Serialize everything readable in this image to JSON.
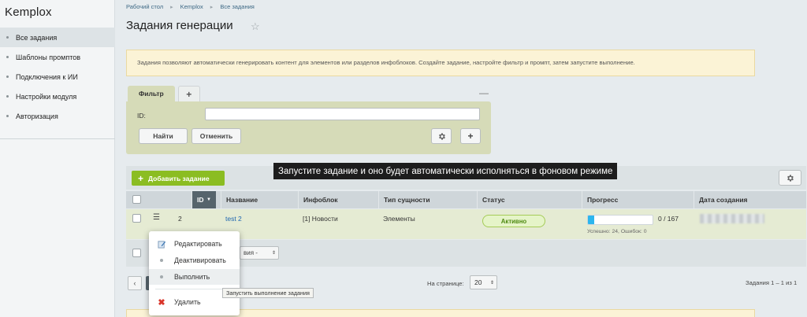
{
  "app": {
    "logo": "Kemplox"
  },
  "sidebar": {
    "items": [
      {
        "label": "Все задания",
        "active": true
      },
      {
        "label": "Шаблоны промптов"
      },
      {
        "label": "Подключения к ИИ"
      },
      {
        "label": "Настройки модуля"
      },
      {
        "label": "Авторизация"
      }
    ]
  },
  "breadcrumb": [
    "Рабочий стол",
    "Kemplox",
    "Все задания"
  ],
  "page": {
    "title": "Задания генерации"
  },
  "info": {
    "text": "Задания позволяют автоматически генерировать контент для элементов или разделов инфоблоков. Создайте задание, настройте фильтр и промпт, затем запустите выполнение."
  },
  "filter": {
    "tab_label": "Фильтр",
    "add_tab": "+",
    "minimize": "—",
    "id_label": "ID:",
    "id_value": "",
    "find_button": "Найти",
    "cancel_button": "Отменить",
    "plus_button": "+"
  },
  "toolbar": {
    "add_button": "Добавить задание",
    "add_plus": "+"
  },
  "table": {
    "columns": [
      "ID",
      "Название",
      "Инфоблок",
      "Тип сущности",
      "Статус",
      "Прогресс",
      "Дата создания"
    ],
    "rows": [
      {
        "id": "2",
        "name": "test 2",
        "iblock": "[1] Новости",
        "entity_type": "Элементы",
        "status": "Активно",
        "progress_text": "0 / 167",
        "progress_fraction": 0.1,
        "progress_details": "Успешно: 24, Ошибок: 0"
      }
    ]
  },
  "actions": {
    "select_label": "вия -"
  },
  "pager": {
    "per_page_label": "На странице:",
    "per_page_value": "20",
    "total": "Задания 1 – 1 из 1"
  },
  "context_menu": {
    "items": [
      {
        "label": "Редактировать",
        "icon": "edit-icon"
      },
      {
        "label": "Деактивировать",
        "icon": "dot-icon"
      },
      {
        "label": "Выполнить",
        "icon": "dot-icon"
      },
      {
        "label": "Удалить",
        "icon": "delete-icon"
      }
    ],
    "tooltip": "Запустить выполнение задания"
  },
  "caption": {
    "text": "Запустите задание и оно будет автоматически исполняться в фоновом режиме"
  },
  "colors": {
    "accent_green": "#8bbd22",
    "progress_blue": "#2cb6ee",
    "filter_bg": "#d6dbb8",
    "row_bg": "#e5ebd3"
  }
}
